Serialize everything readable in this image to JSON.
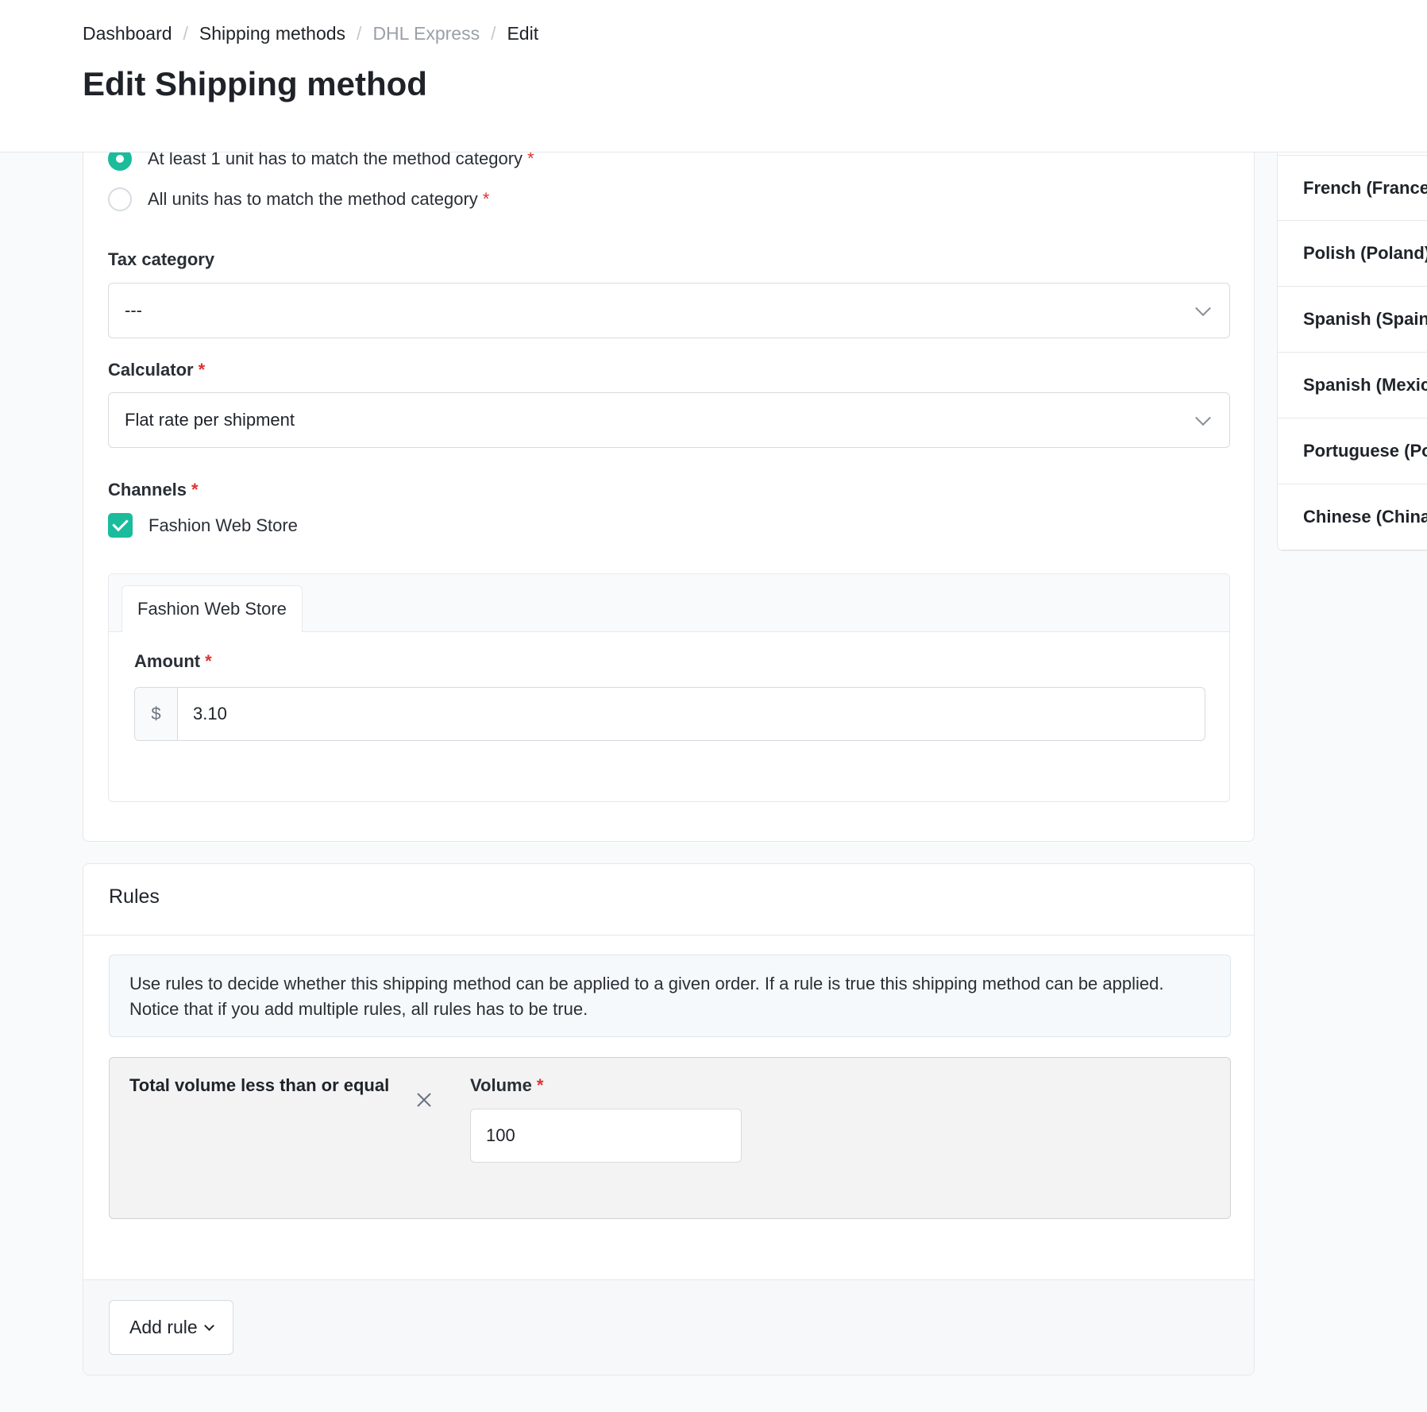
{
  "breadcrumb": {
    "items": [
      "Dashboard",
      "Shipping methods",
      "DHL Express",
      "Edit"
    ]
  },
  "page": {
    "title": "Edit Shipping method"
  },
  "category_requirement": {
    "options": [
      {
        "label": "At least 1 unit has to match the method category",
        "required": "*",
        "selected": true
      },
      {
        "label": "All units has to match the method category",
        "required": "*",
        "selected": false
      }
    ]
  },
  "tax_category": {
    "label": "Tax category",
    "value": "---"
  },
  "calculator": {
    "label": "Calculator",
    "required": "*",
    "value": "Flat rate per shipment"
  },
  "channels": {
    "label": "Channels",
    "required": "*",
    "items": [
      {
        "label": "Fashion Web Store",
        "checked": true
      }
    ]
  },
  "channel_config": {
    "tab_label": "Fashion Web Store",
    "amount_label": "Amount",
    "required": "*",
    "currency_symbol": "$",
    "amount_value": "3.10"
  },
  "rules": {
    "title": "Rules",
    "info_text": "Use rules to decide whether this shipping method can be applied to a given order. If a rule is true this shipping method can be applied. Notice that if you add multiple rules, all rules has to be true.",
    "items": [
      {
        "type_label": "Total volume less than or equal",
        "field_label": "Volume",
        "required": "*",
        "value": "100"
      }
    ],
    "add_rule_label": "Add rule"
  },
  "translations": {
    "locales": [
      "French (France)",
      "Polish (Poland)",
      "Spanish (Spain)",
      "Spanish (Mexico)",
      "Portuguese (Portugal)",
      "Chinese (China)"
    ]
  },
  "colors": {
    "accent": "#1abc9c",
    "required": "#e03131",
    "muted_text": "#9aa0a8",
    "border": "#e6e8eb",
    "page_background": "#f9fafb"
  },
  "icons": {
    "remove_rule": "close-icon",
    "select_caret": "chevron-down-icon",
    "checkbox": "check-icon"
  }
}
